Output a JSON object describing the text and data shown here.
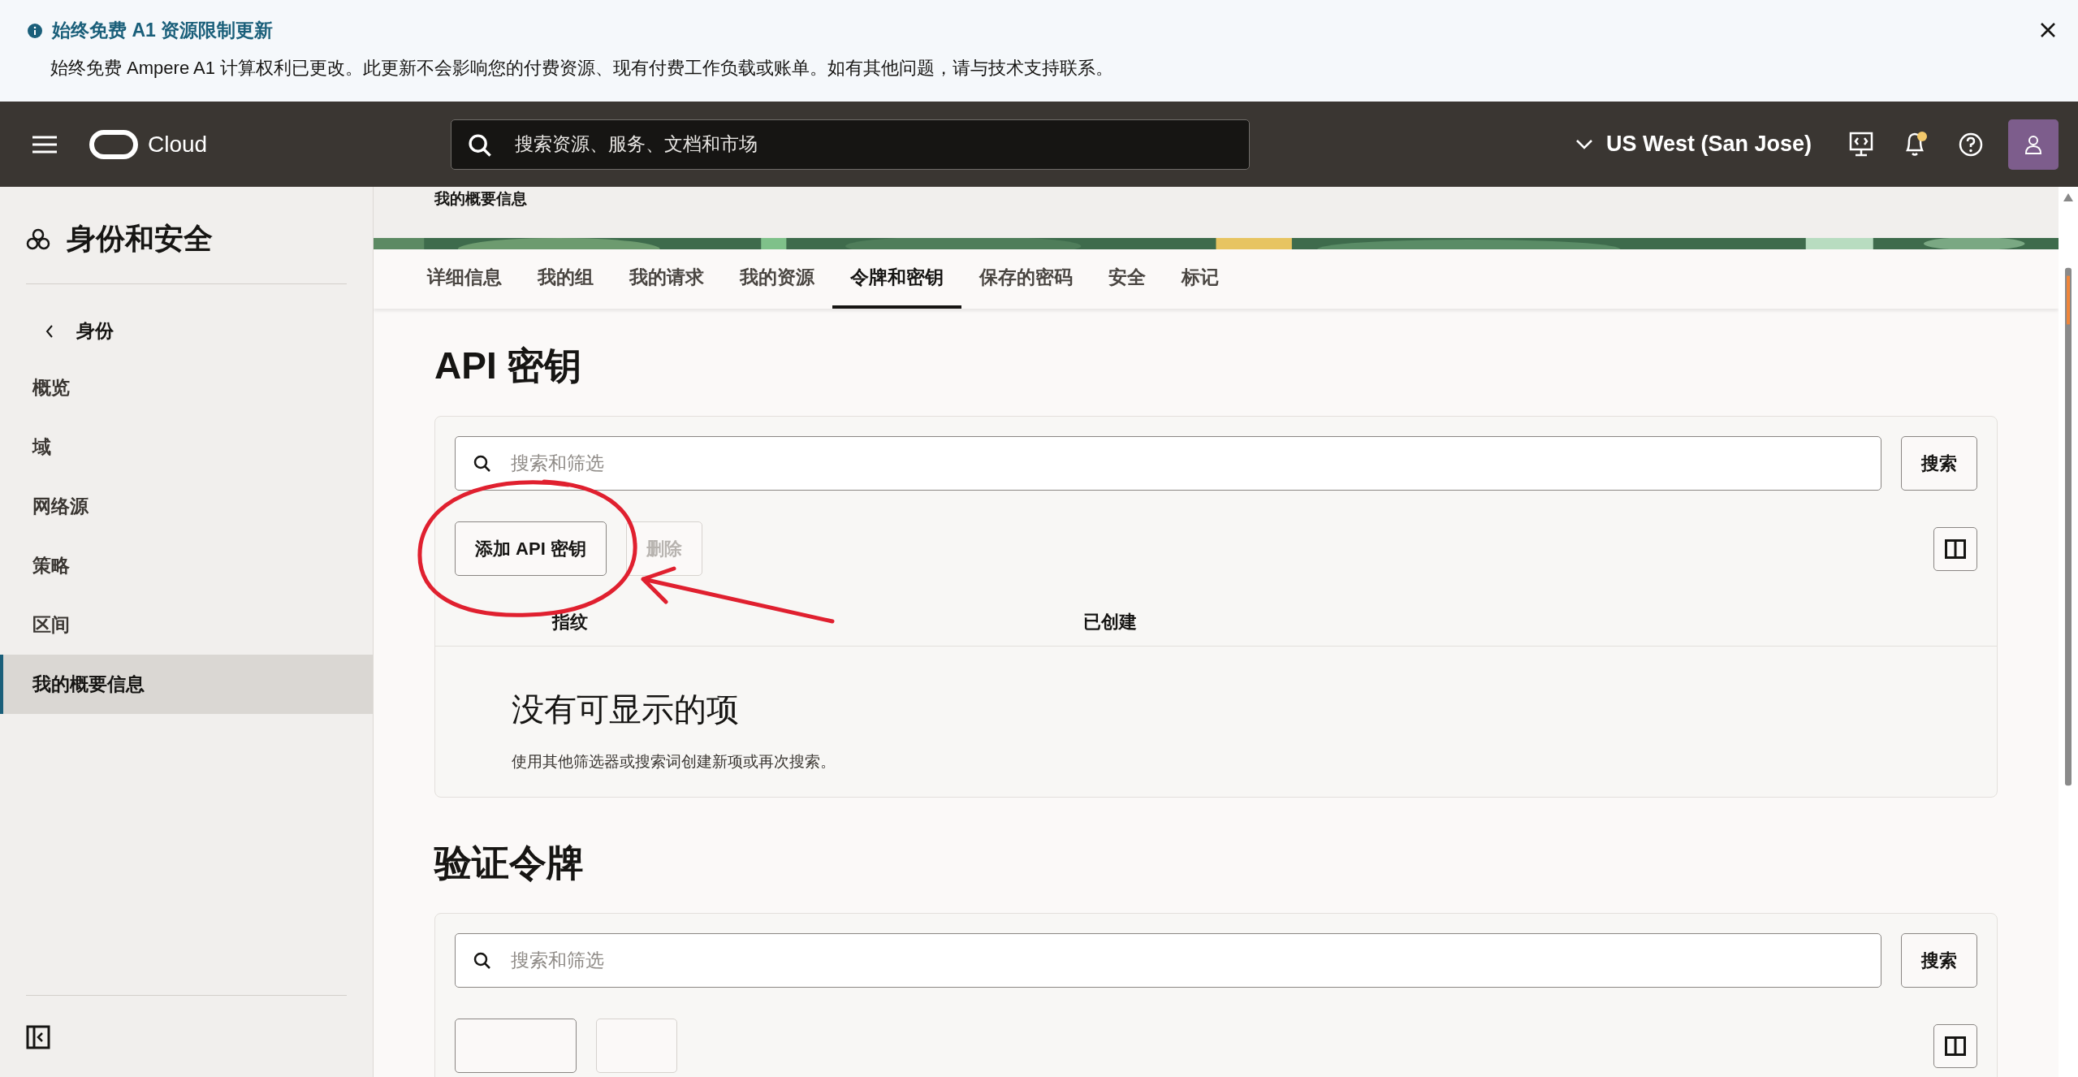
{
  "notice": {
    "title": "始终免费 A1 资源限制更新",
    "message": "始终免费 Ampere A1 计算权利已更改。此更新不会影响您的付费资源、现有付费工作负载或账单。如有其他问题，请与技术支持联系。"
  },
  "header": {
    "brand": "Cloud",
    "search_placeholder": "搜索资源、服务、文档和市场",
    "region": "US West (San Jose)",
    "unread": true
  },
  "sidebar": {
    "title": "身份和安全",
    "back": "身份",
    "items": [
      {
        "label": "概览",
        "selected": false
      },
      {
        "label": "域",
        "selected": false
      },
      {
        "label": "网络源",
        "selected": false
      },
      {
        "label": "策略",
        "selected": false
      },
      {
        "label": "区间",
        "selected": false
      },
      {
        "label": "我的概要信息",
        "selected": true
      }
    ]
  },
  "page": {
    "breadcrumb": "我的概要信息",
    "tabs": [
      {
        "label": "详细信息",
        "selected": false
      },
      {
        "label": "我的组",
        "selected": false
      },
      {
        "label": "我的请求",
        "selected": false
      },
      {
        "label": "我的资源",
        "selected": false
      },
      {
        "label": "令牌和密钥",
        "selected": true
      },
      {
        "label": "保存的密码",
        "selected": false
      },
      {
        "label": "安全",
        "selected": false
      },
      {
        "label": "标记",
        "selected": false
      }
    ],
    "sections": [
      {
        "title": "API 密钥",
        "search_placeholder": "搜索和筛选",
        "search_button": "搜索",
        "buttons": [
          {
            "label": "添加 API 密钥",
            "disabled": false
          },
          {
            "label": "删除",
            "disabled": true
          }
        ],
        "columns": [
          "指纹",
          "已创建"
        ],
        "empty_title": "没有可显示的项",
        "empty_hint": "使用其他筛选器或搜索词创建新项或再次搜索。"
      },
      {
        "title": "验证令牌",
        "search_placeholder": "搜索和筛选",
        "search_button": "搜索",
        "buttons": [
          {
            "disabled": false
          },
          {
            "disabled": true
          }
        ]
      }
    ]
  }
}
